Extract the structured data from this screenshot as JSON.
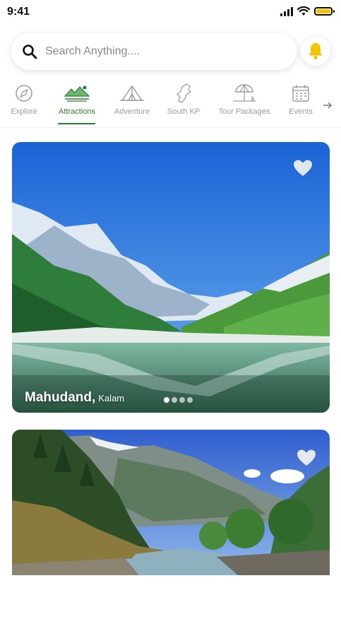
{
  "status_bar": {
    "time": "9:41"
  },
  "search": {
    "placeholder": "Search Anything...."
  },
  "colors": {
    "accent": "#2e7d32",
    "bell": "#f5c400",
    "battery": "#f5c400"
  },
  "tabs": [
    {
      "label": "Explore",
      "icon": "compass-icon",
      "active": false
    },
    {
      "label": "Attractions",
      "icon": "attractions-icon",
      "active": true
    },
    {
      "label": "Adventure",
      "icon": "tent-icon",
      "active": false
    },
    {
      "label": "South KP",
      "icon": "map-region-icon",
      "active": false
    },
    {
      "label": "Tour Packages",
      "icon": "umbrella-icon",
      "active": false
    },
    {
      "label": "Events",
      "icon": "calendar-icon",
      "active": false
    }
  ],
  "cards": [
    {
      "title": "Mahudand,",
      "subtitle": "Kalam",
      "carousel_pages": 4,
      "active_page": 1
    },
    {
      "title": "",
      "subtitle": ""
    }
  ]
}
